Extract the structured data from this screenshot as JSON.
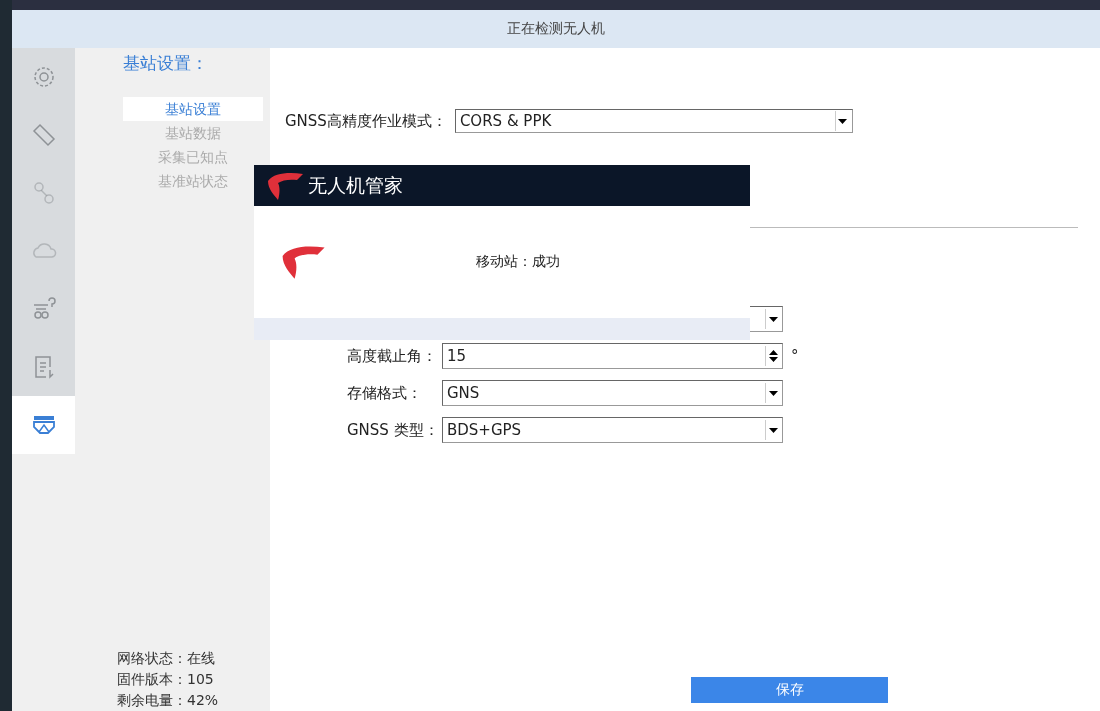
{
  "window": {
    "title": "正在检测无人机"
  },
  "sidebar": {
    "icons": [
      {
        "kind": "gear",
        "selected": false
      },
      {
        "kind": "tag",
        "selected": false
      },
      {
        "kind": "route",
        "selected": false
      },
      {
        "kind": "cloud",
        "selected": false
      },
      {
        "kind": "query",
        "selected": false
      },
      {
        "kind": "list",
        "selected": false
      },
      {
        "kind": "station",
        "selected": true
      }
    ]
  },
  "section_title": "基站设置：",
  "nav": [
    {
      "label": "基站设置",
      "selected": true
    },
    {
      "label": "基站数据",
      "selected": false
    },
    {
      "label": "采集已知点",
      "selected": false
    },
    {
      "label": "基准站状态",
      "selected": false
    }
  ],
  "mode": {
    "label": "GNSS高精度作业模式：",
    "value": "CORS & PPK"
  },
  "fields": [
    {
      "kind": "select"
    },
    {
      "kind": "spin",
      "label": "高度截止角：",
      "value": "15",
      "unit": "°"
    },
    {
      "kind": "select",
      "label": "存储格式：",
      "value": "GNS"
    },
    {
      "kind": "select",
      "label": "GNSS 类型：",
      "value": "BDS+GPS"
    }
  ],
  "dialog": {
    "title": "无人机管家",
    "message": "移动站：成功"
  },
  "status": [
    "网络状态：在线",
    "固件版本：105",
    "剩余电量：42%"
  ],
  "save_button": "保存"
}
